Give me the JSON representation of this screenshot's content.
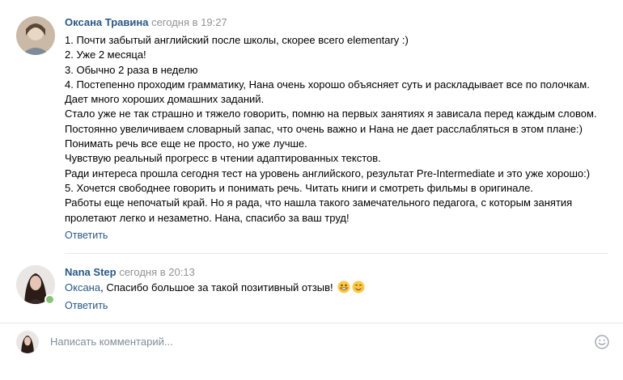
{
  "comment1": {
    "author": "Оксана Травина",
    "time": "сегодня в 19:27",
    "lines": [
      "1. Почти забытый английский после школы, скорее всего elementary :)",
      "2. Уже 2 месяца!",
      "3. Обычно 2 раза в неделю",
      "4. Постепенно проходим грамматику, Нана очень хорошо объясняет суть и раскладывает все по полочкам.",
      "Дает много хороших домашних заданий.",
      "Стало уже не так страшно и тяжело говорить, помню на первых занятиях я зависала перед каждым словом.",
      "Постоянно увеличиваем словарный запас, что очень важно и Нана не дает расслабляться в этом плане:)",
      "Понимать речь все еще не просто, но уже лучше.",
      "Чувствую реальный прогресс в чтении адаптированных текстов.",
      "Ради интереса прошла сегодня тест на уровень английского, результат Pre-Intermediate и это уже хорошо:)",
      "5. Хочется свободнее говорить и понимать речь. Читать книги и смотреть фильмы в оригинале.",
      "Работы еще непочатый край. Но я рада, что нашла такого замечательного педагога, с которым занятия",
      "пролетают легко и незаметно. Нана, спасибо за ваш труд!"
    ],
    "reply_label": "Ответить"
  },
  "comment2": {
    "author": "Nana Step",
    "time": "сегодня в 20:13",
    "mention": "Оксана",
    "text": ", Спасибо большое за такой позитивный отзыв! ",
    "emojis": [
      "grinning-face-icon",
      "smiling-face-icon"
    ],
    "reply_label": "Ответить"
  },
  "composer": {
    "placeholder": "Написать комментарий..."
  },
  "colors": {
    "link": "#2a5885",
    "muted": "#939393",
    "divider": "#e7e8ec",
    "online": "#8ac176"
  }
}
